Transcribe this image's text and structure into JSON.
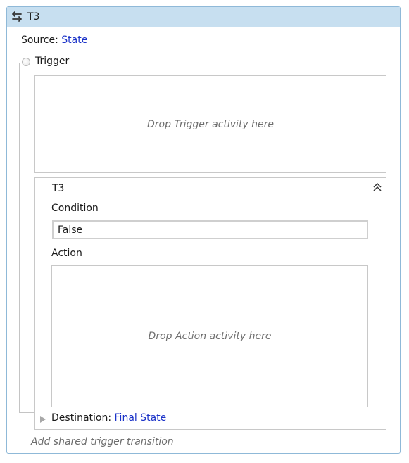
{
  "transition": {
    "title": "T3",
    "source_label": "Source:",
    "source_value": "State",
    "trigger_label": "Trigger",
    "trigger_drop_text": "Drop Trigger activity here",
    "inner": {
      "title": "T3",
      "condition_label": "Condition",
      "condition_value": "False",
      "action_label": "Action",
      "action_drop_text": "Drop Action activity here"
    },
    "destination_label": "Destination:",
    "destination_value": "Final State",
    "shared_trigger_text": "Add shared trigger transition"
  },
  "icons": {
    "title": "transition-arrows-icon",
    "collapse": "double-chevron-up-icon",
    "destination": "arrow-right-icon"
  },
  "colors": {
    "title_bar": "#c7dff0",
    "border": "#8fb9d8",
    "link": "#1a32c8",
    "placeholder": "#6e6e6e"
  }
}
